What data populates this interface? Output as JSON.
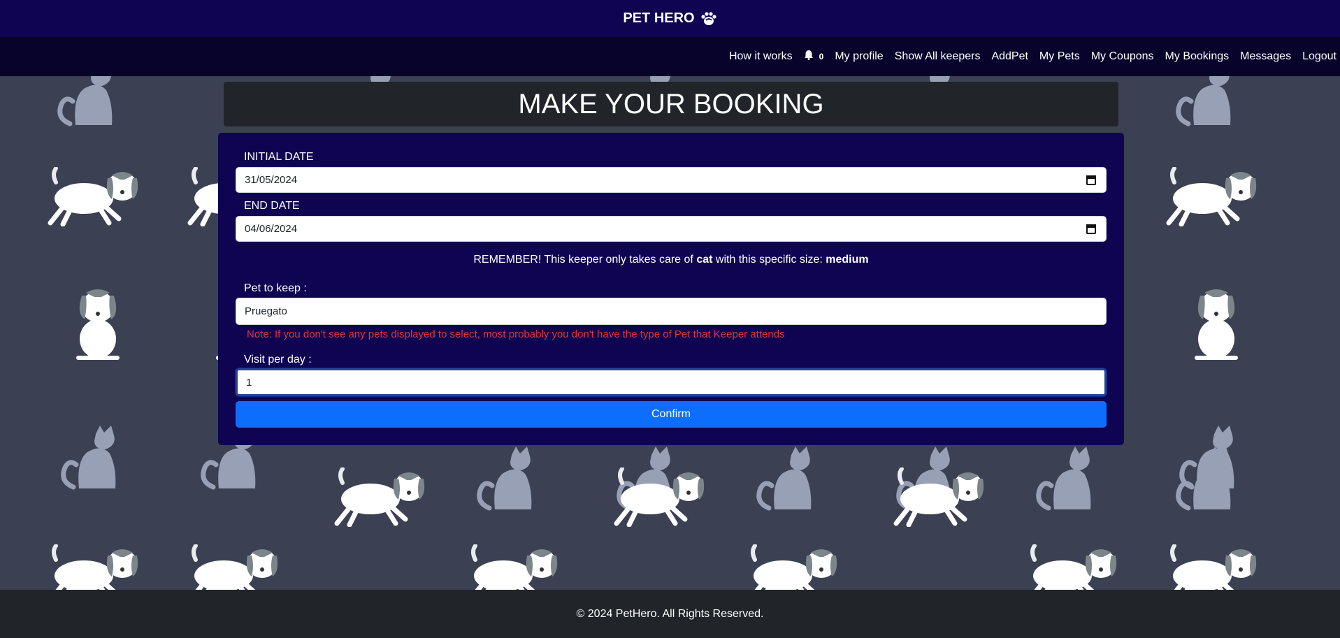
{
  "brand": {
    "title": "PET HERO"
  },
  "nav": {
    "how_it_works": "How it works",
    "notification_count": "0",
    "my_profile": "My profile",
    "show_all_keepers": "Show All keepers",
    "add_pet": "AddPet",
    "my_pets": "My Pets",
    "my_coupons": "My Coupons",
    "my_bookings": "My Bookings",
    "messages": "Messages",
    "logout": "Logout"
  },
  "page": {
    "title": "MAKE YOUR BOOKING"
  },
  "form": {
    "initial_date_label": "INITIAL DATE",
    "initial_date_value": "31/05/2024",
    "end_date_label": "END DATE",
    "end_date_value": "04/06/2024",
    "remember_prefix": "REMEMBER! This keeper only takes care of ",
    "pet_type": "cat",
    "remember_middle": " with this specific size: ",
    "pet_size": "medium",
    "pet_label": "Pet to keep :",
    "pet_value": "Pruegato",
    "note": "Note: If you don't see any pets displayed to select, most probably you don't have the type of Pet that Keeper attends",
    "visits_label": "Visit per day :",
    "visits_value": "1",
    "confirm_label": "Confirm"
  },
  "footer": {
    "text": "© 2024 PetHero. All Rights Reserved."
  },
  "colors": {
    "brand_bar": "#0f0451",
    "nav_bar": "#07032b",
    "background": "#3b4152",
    "card": "#0f0451",
    "confirm": "#0d6efd",
    "note": "#dc3545",
    "footer": "#212529"
  },
  "icons": [
    "paw-icon",
    "bell-icon",
    "calendar-icon",
    "cat-illustration",
    "dog-illustration"
  ]
}
